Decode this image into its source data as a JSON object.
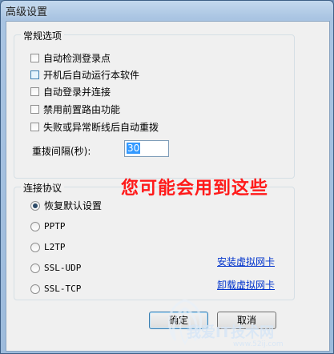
{
  "window": {
    "title": "高级设置"
  },
  "general": {
    "title": "常规选项",
    "options": [
      {
        "label": "自动检测登录点",
        "checked": false
      },
      {
        "label": "开机后自动运行本软件",
        "checked": false
      },
      {
        "label": "自动登录并连接",
        "checked": false
      },
      {
        "label": "禁用前置路由功能",
        "checked": false
      },
      {
        "label": "失败或异常断线后自动重拨",
        "checked": false
      }
    ],
    "redial_label": "重拨间隔(秒):",
    "redial_value": "30"
  },
  "protocol": {
    "title": "连接协议",
    "options": [
      {
        "label": "恢复默认设置",
        "selected": true
      },
      {
        "label": "PPTP",
        "selected": false
      },
      {
        "label": "L2TP",
        "selected": false
      },
      {
        "label": "SSL-UDP",
        "selected": false
      },
      {
        "label": "SSL-TCP",
        "selected": false
      }
    ],
    "install_link": "安装虚拟网卡",
    "uninstall_link": "卸载虚拟网卡"
  },
  "annotation": "您可能会用到这些",
  "buttons": {
    "ok": "确定",
    "cancel": "取消"
  },
  "watermark": {
    "text": "我爱IT技术网",
    "url": "www.52ij.com"
  }
}
